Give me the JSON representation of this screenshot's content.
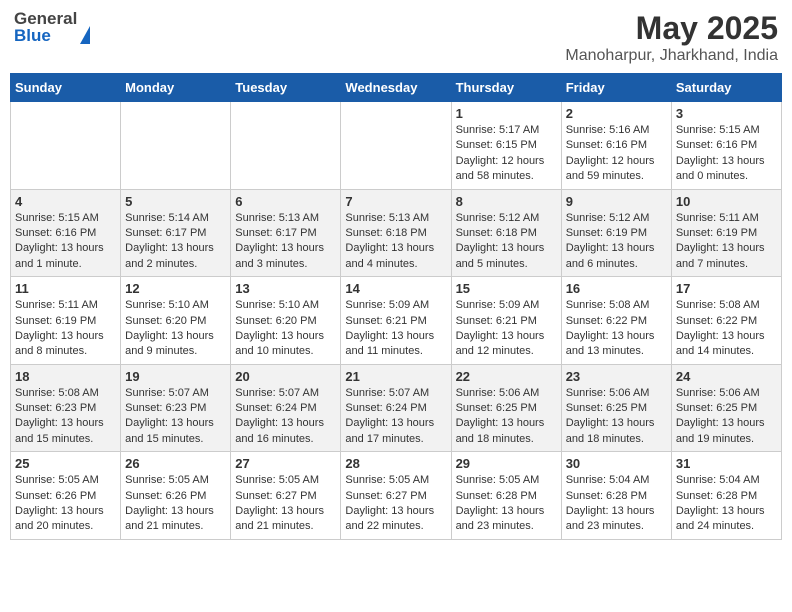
{
  "header": {
    "logo_general": "General",
    "logo_blue": "Blue",
    "month_title": "May 2025",
    "location": "Manoharpur, Jharkhand, India"
  },
  "days_of_week": [
    "Sunday",
    "Monday",
    "Tuesday",
    "Wednesday",
    "Thursday",
    "Friday",
    "Saturday"
  ],
  "weeks": [
    {
      "bg": "white",
      "days": [
        {
          "num": "",
          "info": ""
        },
        {
          "num": "",
          "info": ""
        },
        {
          "num": "",
          "info": ""
        },
        {
          "num": "",
          "info": ""
        },
        {
          "num": "1",
          "info": "Sunrise: 5:17 AM\nSunset: 6:15 PM\nDaylight: 12 hours\nand 58 minutes."
        },
        {
          "num": "2",
          "info": "Sunrise: 5:16 AM\nSunset: 6:16 PM\nDaylight: 12 hours\nand 59 minutes."
        },
        {
          "num": "3",
          "info": "Sunrise: 5:15 AM\nSunset: 6:16 PM\nDaylight: 13 hours\nand 0 minutes."
        }
      ]
    },
    {
      "bg": "light",
      "days": [
        {
          "num": "4",
          "info": "Sunrise: 5:15 AM\nSunset: 6:16 PM\nDaylight: 13 hours\nand 1 minute."
        },
        {
          "num": "5",
          "info": "Sunrise: 5:14 AM\nSunset: 6:17 PM\nDaylight: 13 hours\nand 2 minutes."
        },
        {
          "num": "6",
          "info": "Sunrise: 5:13 AM\nSunset: 6:17 PM\nDaylight: 13 hours\nand 3 minutes."
        },
        {
          "num": "7",
          "info": "Sunrise: 5:13 AM\nSunset: 6:18 PM\nDaylight: 13 hours\nand 4 minutes."
        },
        {
          "num": "8",
          "info": "Sunrise: 5:12 AM\nSunset: 6:18 PM\nDaylight: 13 hours\nand 5 minutes."
        },
        {
          "num": "9",
          "info": "Sunrise: 5:12 AM\nSunset: 6:19 PM\nDaylight: 13 hours\nand 6 minutes."
        },
        {
          "num": "10",
          "info": "Sunrise: 5:11 AM\nSunset: 6:19 PM\nDaylight: 13 hours\nand 7 minutes."
        }
      ]
    },
    {
      "bg": "white",
      "days": [
        {
          "num": "11",
          "info": "Sunrise: 5:11 AM\nSunset: 6:19 PM\nDaylight: 13 hours\nand 8 minutes."
        },
        {
          "num": "12",
          "info": "Sunrise: 5:10 AM\nSunset: 6:20 PM\nDaylight: 13 hours\nand 9 minutes."
        },
        {
          "num": "13",
          "info": "Sunrise: 5:10 AM\nSunset: 6:20 PM\nDaylight: 13 hours\nand 10 minutes."
        },
        {
          "num": "14",
          "info": "Sunrise: 5:09 AM\nSunset: 6:21 PM\nDaylight: 13 hours\nand 11 minutes."
        },
        {
          "num": "15",
          "info": "Sunrise: 5:09 AM\nSunset: 6:21 PM\nDaylight: 13 hours\nand 12 minutes."
        },
        {
          "num": "16",
          "info": "Sunrise: 5:08 AM\nSunset: 6:22 PM\nDaylight: 13 hours\nand 13 minutes."
        },
        {
          "num": "17",
          "info": "Sunrise: 5:08 AM\nSunset: 6:22 PM\nDaylight: 13 hours\nand 14 minutes."
        }
      ]
    },
    {
      "bg": "light",
      "days": [
        {
          "num": "18",
          "info": "Sunrise: 5:08 AM\nSunset: 6:23 PM\nDaylight: 13 hours\nand 15 minutes."
        },
        {
          "num": "19",
          "info": "Sunrise: 5:07 AM\nSunset: 6:23 PM\nDaylight: 13 hours\nand 15 minutes."
        },
        {
          "num": "20",
          "info": "Sunrise: 5:07 AM\nSunset: 6:24 PM\nDaylight: 13 hours\nand 16 minutes."
        },
        {
          "num": "21",
          "info": "Sunrise: 5:07 AM\nSunset: 6:24 PM\nDaylight: 13 hours\nand 17 minutes."
        },
        {
          "num": "22",
          "info": "Sunrise: 5:06 AM\nSunset: 6:25 PM\nDaylight: 13 hours\nand 18 minutes."
        },
        {
          "num": "23",
          "info": "Sunrise: 5:06 AM\nSunset: 6:25 PM\nDaylight: 13 hours\nand 18 minutes."
        },
        {
          "num": "24",
          "info": "Sunrise: 5:06 AM\nSunset: 6:25 PM\nDaylight: 13 hours\nand 19 minutes."
        }
      ]
    },
    {
      "bg": "white",
      "days": [
        {
          "num": "25",
          "info": "Sunrise: 5:05 AM\nSunset: 6:26 PM\nDaylight: 13 hours\nand 20 minutes."
        },
        {
          "num": "26",
          "info": "Sunrise: 5:05 AM\nSunset: 6:26 PM\nDaylight: 13 hours\nand 21 minutes."
        },
        {
          "num": "27",
          "info": "Sunrise: 5:05 AM\nSunset: 6:27 PM\nDaylight: 13 hours\nand 21 minutes."
        },
        {
          "num": "28",
          "info": "Sunrise: 5:05 AM\nSunset: 6:27 PM\nDaylight: 13 hours\nand 22 minutes."
        },
        {
          "num": "29",
          "info": "Sunrise: 5:05 AM\nSunset: 6:28 PM\nDaylight: 13 hours\nand 23 minutes."
        },
        {
          "num": "30",
          "info": "Sunrise: 5:04 AM\nSunset: 6:28 PM\nDaylight: 13 hours\nand 23 minutes."
        },
        {
          "num": "31",
          "info": "Sunrise: 5:04 AM\nSunset: 6:28 PM\nDaylight: 13 hours\nand 24 minutes."
        }
      ]
    }
  ]
}
